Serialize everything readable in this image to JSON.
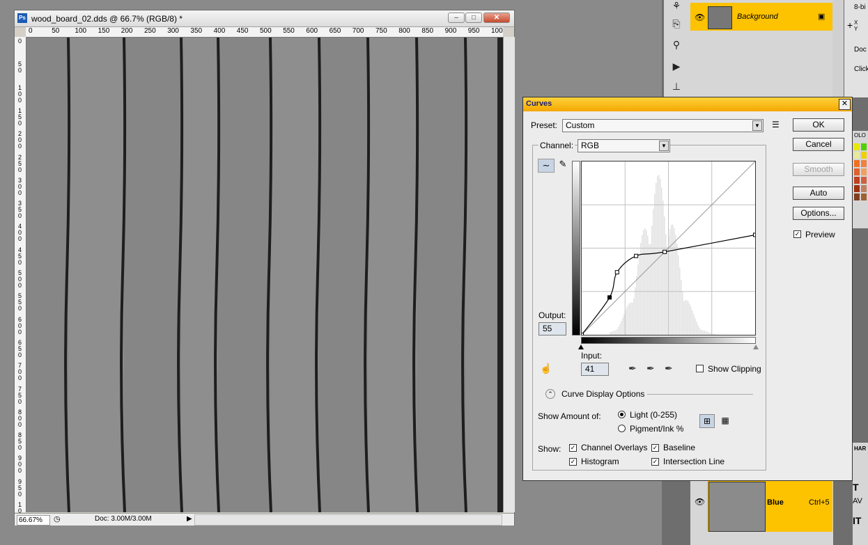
{
  "document_window": {
    "title": "wood_board_02.dds @ 66.7% (RGB/8) *",
    "ps_icon": "Ps",
    "minimize": "–",
    "maximize": "□",
    "close": "✕",
    "ruler_top_labels": [
      "0",
      "50",
      "100",
      "150",
      "200",
      "250",
      "300",
      "350",
      "400",
      "450",
      "500",
      "550",
      "600",
      "650",
      "700",
      "750",
      "800",
      "850",
      "900",
      "950",
      "100"
    ],
    "ruler_left_labels": [
      "0",
      "50",
      "100",
      "150",
      "200",
      "250",
      "300",
      "350",
      "400",
      "450",
      "500",
      "550",
      "600",
      "650",
      "700",
      "750",
      "800",
      "850",
      "900",
      "950",
      "100"
    ],
    "status": {
      "zoom": "66.67%",
      "doc_info": "Doc: 3.00M/3.00M",
      "arrow": "▶"
    }
  },
  "layers": {
    "background": {
      "name": "Background",
      "lock": "🔒"
    },
    "blue": {
      "name": "Blue",
      "shortcut": "Ctrl+5"
    }
  },
  "info_panel": {
    "bit_depth": "8-bi",
    "xy": "X\nY",
    "doc": "Doc",
    "click": "Click"
  },
  "curves": {
    "title": "Curves",
    "close": "✕",
    "preset_label": "Preset:",
    "preset_value": "Custom",
    "channel_label": "Channel:",
    "channel_value": "RGB",
    "output_label": "Output:",
    "output_value": "55",
    "input_label": "Input:",
    "input_value": "41",
    "show_clipping": "Show Clipping",
    "curve_display_options": "Curve Display Options",
    "show_amount_of": "Show Amount of:",
    "light": "Light  (0-255)",
    "pigment": "Pigment/Ink %",
    "show_label": "Show:",
    "channel_overlays": "Channel Overlays",
    "baseline": "Baseline",
    "histogram": "Histogram",
    "intersection_line": "Intersection Line",
    "buttons": {
      "ok": "OK",
      "cancel": "Cancel",
      "smooth": "Smooth",
      "auto": "Auto",
      "options": "Options..."
    },
    "preview": "Preview",
    "checks": {
      "show_clipping": false,
      "channel_overlays": true,
      "baseline": true,
      "histogram": true,
      "intersection_line": true,
      "preview": true
    },
    "light_selected": true,
    "curve_points": [
      [
        0,
        0
      ],
      [
        41,
        55
      ],
      [
        52,
        92
      ],
      [
        80,
        116
      ],
      [
        122,
        122
      ],
      [
        255,
        147
      ]
    ]
  },
  "colors": {
    "accent": "#fdc200",
    "dialog_title": "#f5a700",
    "canvas_wood": "#8b8b8b"
  }
}
